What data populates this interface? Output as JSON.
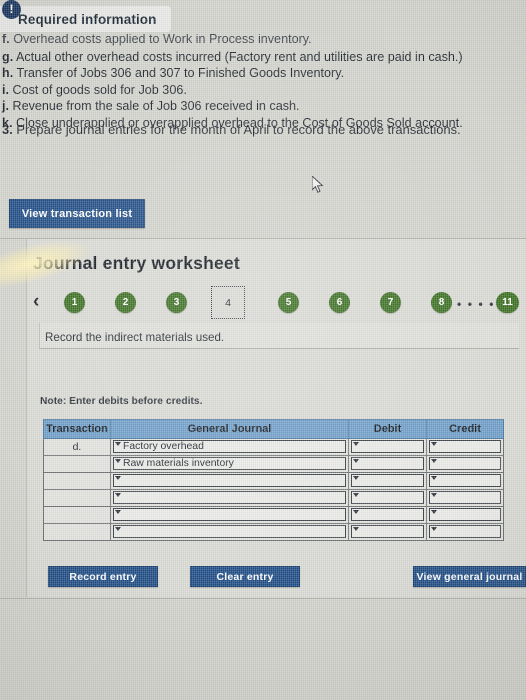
{
  "header": {
    "title": "Required information",
    "icon": "exclamation-icon"
  },
  "requirements": {
    "items": [
      {
        "letter": "f.",
        "text": "Overhead costs applied to Work in Process inventory.",
        "clipped": true
      },
      {
        "letter": "g.",
        "text": "Actual other overhead costs incurred (Factory rent and utilities are paid in cash.)",
        "clipped": false
      },
      {
        "letter": "h.",
        "text": "Transfer of Jobs 306 and 307 to Finished Goods Inventory.",
        "clipped": false
      },
      {
        "letter": "i.",
        "text": "Cost of goods sold for Job 306.",
        "clipped": false
      },
      {
        "letter": "j.",
        "text": "Revenue from the sale of Job 306 received in cash.",
        "clipped": false
      },
      {
        "letter": "k.",
        "text": "Close underapplied or overapplied overhead to the Cost of Goods Sold account.",
        "clipped": false
      }
    ],
    "question_number": "3.",
    "question_text": "Prepare journal entries for the month of April to record the above transactions."
  },
  "toolbar": {
    "view_transaction_list": "View transaction list"
  },
  "worksheet": {
    "title": "Journal entry worksheet",
    "prev_arrow": "‹",
    "steps": [
      {
        "label": "1",
        "state": "done"
      },
      {
        "label": "2",
        "state": "done"
      },
      {
        "label": "3",
        "state": "done"
      },
      {
        "label": "4",
        "state": "current"
      },
      {
        "label": "5",
        "state": "done"
      },
      {
        "label": "6",
        "state": "done"
      },
      {
        "label": "7",
        "state": "done"
      },
      {
        "label": "8",
        "state": "done"
      },
      {
        "label": "11",
        "state": "done"
      }
    ],
    "ellipsis": "• • • • •",
    "prompt": "Record the indirect materials used.",
    "note": "Note: Enter debits before credits."
  },
  "table": {
    "columns": [
      "Transaction",
      "General Journal",
      "Debit",
      "Credit"
    ],
    "rows": [
      {
        "transaction": "d.",
        "general_journal": "Factory overhead",
        "debit": "",
        "credit": ""
      },
      {
        "transaction": "",
        "general_journal": "Raw materials inventory",
        "debit": "",
        "credit": ""
      },
      {
        "transaction": "",
        "general_journal": "",
        "debit": "",
        "credit": ""
      },
      {
        "transaction": "",
        "general_journal": "",
        "debit": "",
        "credit": ""
      },
      {
        "transaction": "",
        "general_journal": "",
        "debit": "",
        "credit": ""
      },
      {
        "transaction": "",
        "general_journal": "",
        "debit": "",
        "credit": ""
      }
    ]
  },
  "footer": {
    "record_entry": "Record entry",
    "clear_entry": "Clear entry",
    "view_general_journal": "View general journal"
  },
  "colors": {
    "button_blue": "#1f4c85",
    "pill_green": "#3a6e20",
    "table_header_blue": "#6d9dc8",
    "page_background": "#d2d2cc"
  }
}
